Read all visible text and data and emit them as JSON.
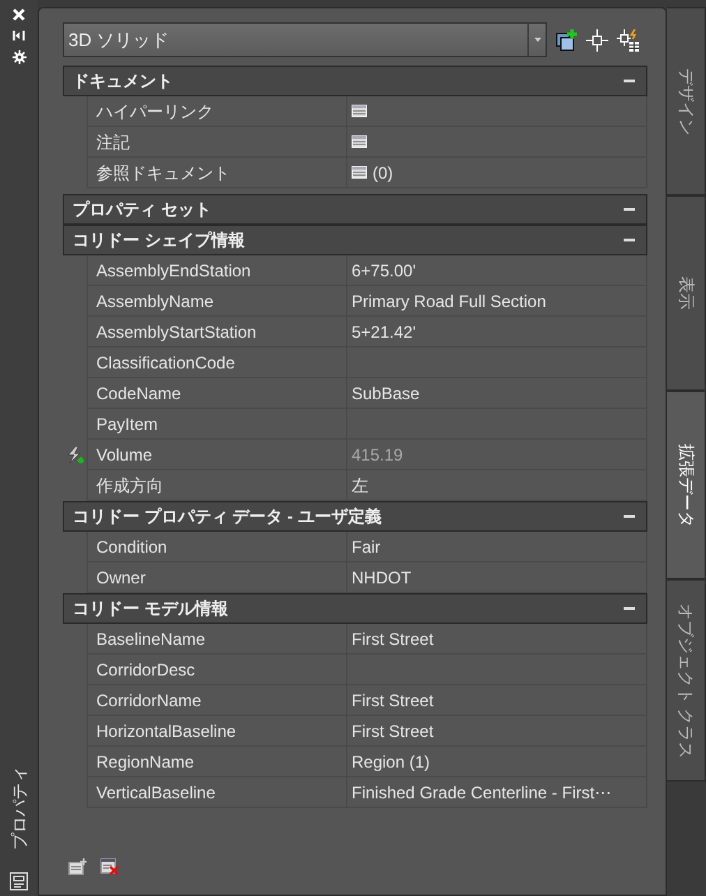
{
  "palette_title": "プロパティ",
  "object_dropdown": {
    "value": "3D ソリッド"
  },
  "sections": [
    {
      "title": "ドキュメント",
      "expanded": true,
      "rows": [
        {
          "label": "ハイパーリンク",
          "kind": "list"
        },
        {
          "label": "注記",
          "kind": "list"
        },
        {
          "label": "参照ドキュメント",
          "kind": "list",
          "value": "(0)"
        }
      ]
    },
    {
      "title": "プロパティ セット",
      "expanded": true
    },
    {
      "title": "コリドー シェイプ情報",
      "expanded": true,
      "rows": [
        {
          "label": "AssemblyEndStation",
          "kind": "text",
          "value": "6+75.00'"
        },
        {
          "label": "AssemblyName",
          "kind": "text",
          "value": "Primary Road Full Section"
        },
        {
          "label": "AssemblyStartStation",
          "kind": "text",
          "value": "5+21.42'"
        },
        {
          "label": "ClassificationCode",
          "kind": "text"
        },
        {
          "label": "CodeName",
          "kind": "text",
          "value": "SubBase"
        },
        {
          "label": "PayItem",
          "kind": "text"
        },
        {
          "label": "Volume",
          "kind": "dynamic",
          "value": "415.19"
        },
        {
          "label": "作成方向",
          "kind": "text",
          "value": "左"
        }
      ]
    },
    {
      "title": "コリドー プロパティ データ - ユーザ定義",
      "expanded": true,
      "rows": [
        {
          "label": "Condition",
          "kind": "text",
          "value": "Fair"
        },
        {
          "label": "Owner",
          "kind": "text",
          "value": "NHDOT"
        }
      ]
    },
    {
      "title": "コリドー モデル情報",
      "expanded": true,
      "rows": [
        {
          "label": "BaselineName",
          "kind": "text",
          "value": "First Street"
        },
        {
          "label": "CorridorDesc",
          "kind": "text"
        },
        {
          "label": "CorridorName",
          "kind": "text",
          "value": "First Street"
        },
        {
          "label": "HorizontalBaseline",
          "kind": "text",
          "value": "First Street"
        },
        {
          "label": "RegionName",
          "kind": "text",
          "value": "Region (1)"
        },
        {
          "label": "VerticalBaseline",
          "kind": "text",
          "value": "Finished Grade Centerline - First⋯"
        }
      ]
    }
  ],
  "tabs": [
    {
      "label": "デザイン",
      "selected": false
    },
    {
      "label": "表示",
      "selected": false
    },
    {
      "label": "拡張データ",
      "selected": true
    },
    {
      "label": "オブジェクト クラス",
      "selected": false
    }
  ]
}
